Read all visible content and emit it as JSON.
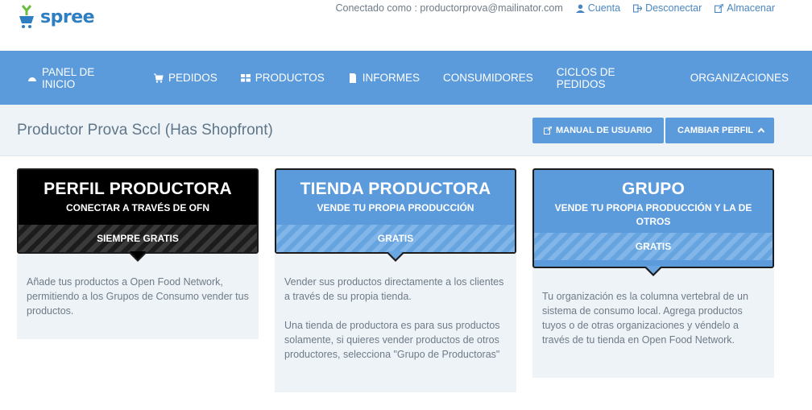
{
  "brand": {
    "name": "spree",
    "accent": "#5b9bdc"
  },
  "user_bar": {
    "connected_as": "Conectado como : productorprova@mailinator.com",
    "links": [
      {
        "label": "Cuenta",
        "icon": "user-icon"
      },
      {
        "label": "Desconectar",
        "icon": "sign-out-icon"
      },
      {
        "label": "Almacenar",
        "icon": "external-link-icon"
      }
    ]
  },
  "nav": [
    {
      "label": "PANEL DE INICIO",
      "icon": "dashboard-icon"
    },
    {
      "label": "PEDIDOS",
      "icon": "cart-icon"
    },
    {
      "label": "PRODUCTOS",
      "icon": "grid-icon"
    },
    {
      "label": "INFORMES",
      "icon": "file-icon"
    },
    {
      "label": "CONSUMIDORES",
      "icon": ""
    },
    {
      "label": "CICLOS DE PEDIDOS",
      "icon": ""
    },
    {
      "label": "ORGANIZACIONES",
      "icon": ""
    }
  ],
  "page": {
    "title": "Productor Prova Sccl (Has Shopfront)",
    "manual_btn": "MANUAL DE USUARIO",
    "change_profile_btn": "CAMBIAR PERFIL"
  },
  "cards": [
    {
      "title": "PERFIL PRODUCTORA",
      "subtitle": "CONECTAR A TRAVÉS DE OFN",
      "price": "SIEMPRE GRATIS",
      "body": [
        "Añade tus productos a Open Food Network, permitiendo a los Grupos de Consumo vender tus productos."
      ]
    },
    {
      "title": "TIENDA PRODUCTORA",
      "subtitle": "VENDE TU PROPIA PRODUCCIÓN",
      "price": "GRATIS",
      "body": [
        "Vender sus productos directamente a los clientes a través de su propia tienda.",
        "Una tienda de productora es para sus productos solamente, si quieres vender productos de otros productores, selecciona \"Grupo de Productoras\""
      ]
    },
    {
      "title": "GRUPO",
      "subtitle": "VENDE TU PROPIA PRODUCCIÓN Y LA DE OTROS",
      "price": "GRATIS",
      "body": [
        "Tu organización es la columna vertebral de un sistema de consumo local. Agrega productos tuyos o de otras organizaciones y véndelo a través de tu tienda en Open Food Network."
      ]
    }
  ]
}
